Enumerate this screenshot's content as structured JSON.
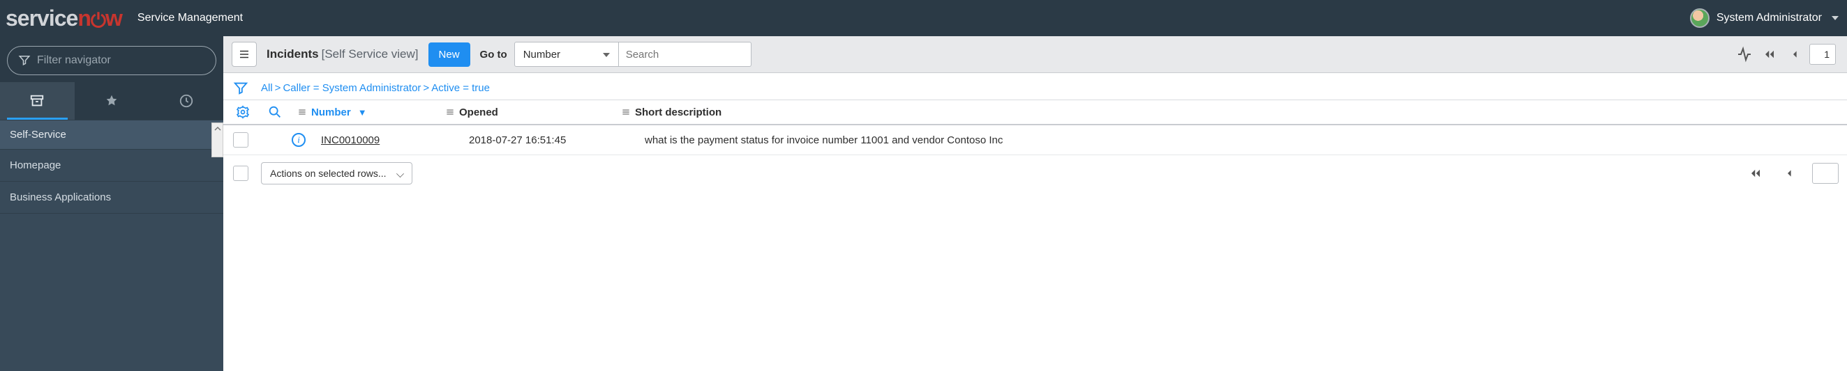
{
  "header": {
    "app_title": "Service Management",
    "user_name": "System Administrator"
  },
  "sidebar": {
    "filter_placeholder": "Filter navigator",
    "section_label": "Self-Service",
    "items": [
      {
        "label": "Homepage"
      },
      {
        "label": "Business Applications"
      }
    ]
  },
  "toolbar": {
    "title_bold": "Incidents",
    "title_muted": "[Self Service view]",
    "new_label": "New",
    "goto_label": "Go to",
    "goto_field": "Number",
    "search_placeholder": "Search",
    "page_value": "1"
  },
  "breadcrumbs": {
    "all": "All",
    "caller": "Caller = System Administrator",
    "active": "Active = true"
  },
  "columns": {
    "number": "Number",
    "opened": "Opened",
    "desc": "Short description"
  },
  "rows": [
    {
      "number": "INC0010009",
      "opened": "2018-07-27 16:51:45",
      "desc": "what is the payment status for invoice number 11001 and vendor Contoso Inc"
    }
  ],
  "footer": {
    "actions_label": "Actions on selected rows..."
  }
}
